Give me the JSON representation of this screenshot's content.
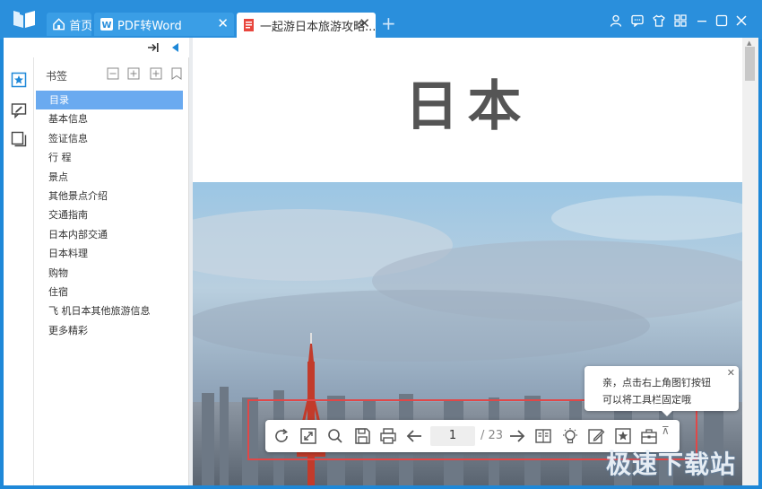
{
  "tabs": [
    {
      "label": "首页",
      "icon": "home-icon"
    },
    {
      "label": "PDF转Word",
      "icon": "pdf-to-word-icon"
    },
    {
      "label": "一起游日本旅游攻略...",
      "icon": "pdf-file-icon",
      "active": true
    }
  ],
  "bookmarks": {
    "title": "书签",
    "items": [
      "目录",
      "基本信息",
      "签证信息",
      "行  程",
      "景点",
      "其他景点介绍",
      "交通指南",
      "日本内部交通",
      "日本料理",
      "购物",
      "住宿",
      "飞  机日本其他旅游信息",
      "更多精彩"
    ],
    "selected_index": 0
  },
  "document": {
    "title": "日本"
  },
  "toolbar": {
    "current_page": "1",
    "total_pages": "/ 23"
  },
  "tooltip": {
    "line1": "亲，点击右上角图钉按钮",
    "line2": "可以将工具栏固定哦"
  },
  "watermark": "极速下载站",
  "colors": {
    "titlebar": "#2a8fdc",
    "selected": "#6aaaf0",
    "highlight_box": "#e04848"
  }
}
